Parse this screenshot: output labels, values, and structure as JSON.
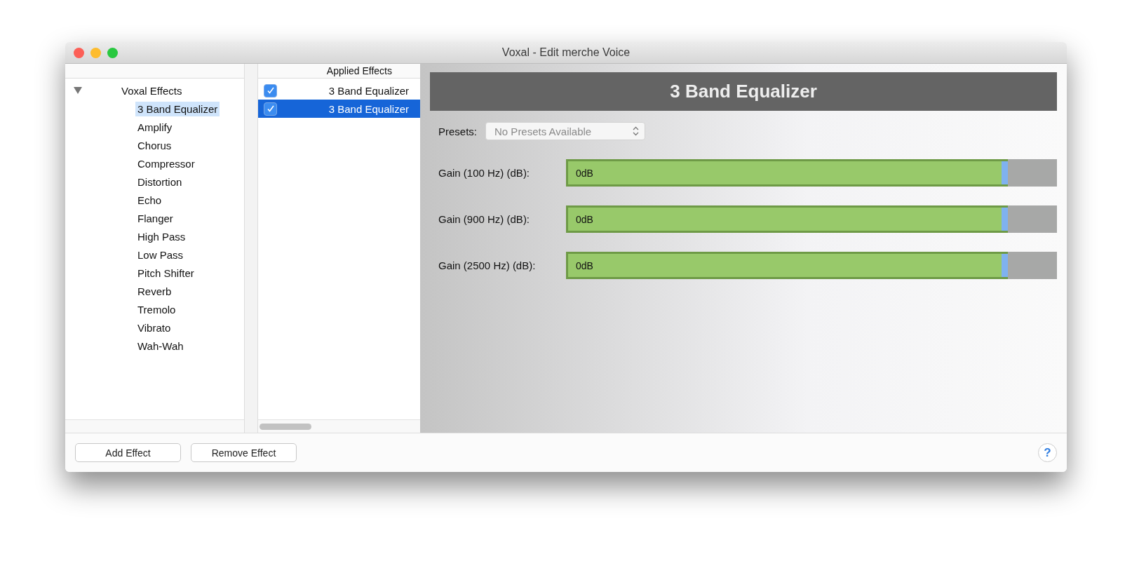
{
  "window": {
    "title": "Voxal - Edit merche Voice"
  },
  "effects_tree": {
    "label": "Voxal Effects",
    "expanded": true,
    "children": [
      {
        "label": "3 Band Equalizer",
        "selected": true
      },
      {
        "label": "Amplify",
        "selected": false
      },
      {
        "label": "Chorus",
        "selected": false
      },
      {
        "label": "Compressor",
        "selected": false
      },
      {
        "label": "Distortion",
        "selected": false
      },
      {
        "label": "Echo",
        "selected": false
      },
      {
        "label": "Flanger",
        "selected": false
      },
      {
        "label": "High Pass",
        "selected": false
      },
      {
        "label": "Low Pass",
        "selected": false
      },
      {
        "label": "Pitch Shifter",
        "selected": false
      },
      {
        "label": "Reverb",
        "selected": false
      },
      {
        "label": "Tremolo",
        "selected": false
      },
      {
        "label": "Vibrato",
        "selected": false
      },
      {
        "label": "Wah-Wah",
        "selected": false
      }
    ]
  },
  "applied_effects": {
    "header": "Applied Effects",
    "rows": [
      {
        "label": "3 Band Equalizer",
        "checked": true,
        "selected": false
      },
      {
        "label": "3 Band Equalizer",
        "checked": true,
        "selected": true
      }
    ]
  },
  "effect_panel": {
    "title": "3 Band Equalizer",
    "presets_label": "Presets:",
    "presets_value": "No Presets Available",
    "sliders": [
      {
        "label": "Gain (100 Hz) (dB):",
        "reading": "0dB",
        "level": 0.9
      },
      {
        "label": "Gain (900 Hz) (dB):",
        "reading": "0dB",
        "level": 0.9
      },
      {
        "label": "Gain (2500 Hz) (dB):",
        "reading": "0dB",
        "level": 0.9
      }
    ]
  },
  "buttons": [
    "Add Effect",
    "Remove Effect"
  ],
  "help": "?"
}
